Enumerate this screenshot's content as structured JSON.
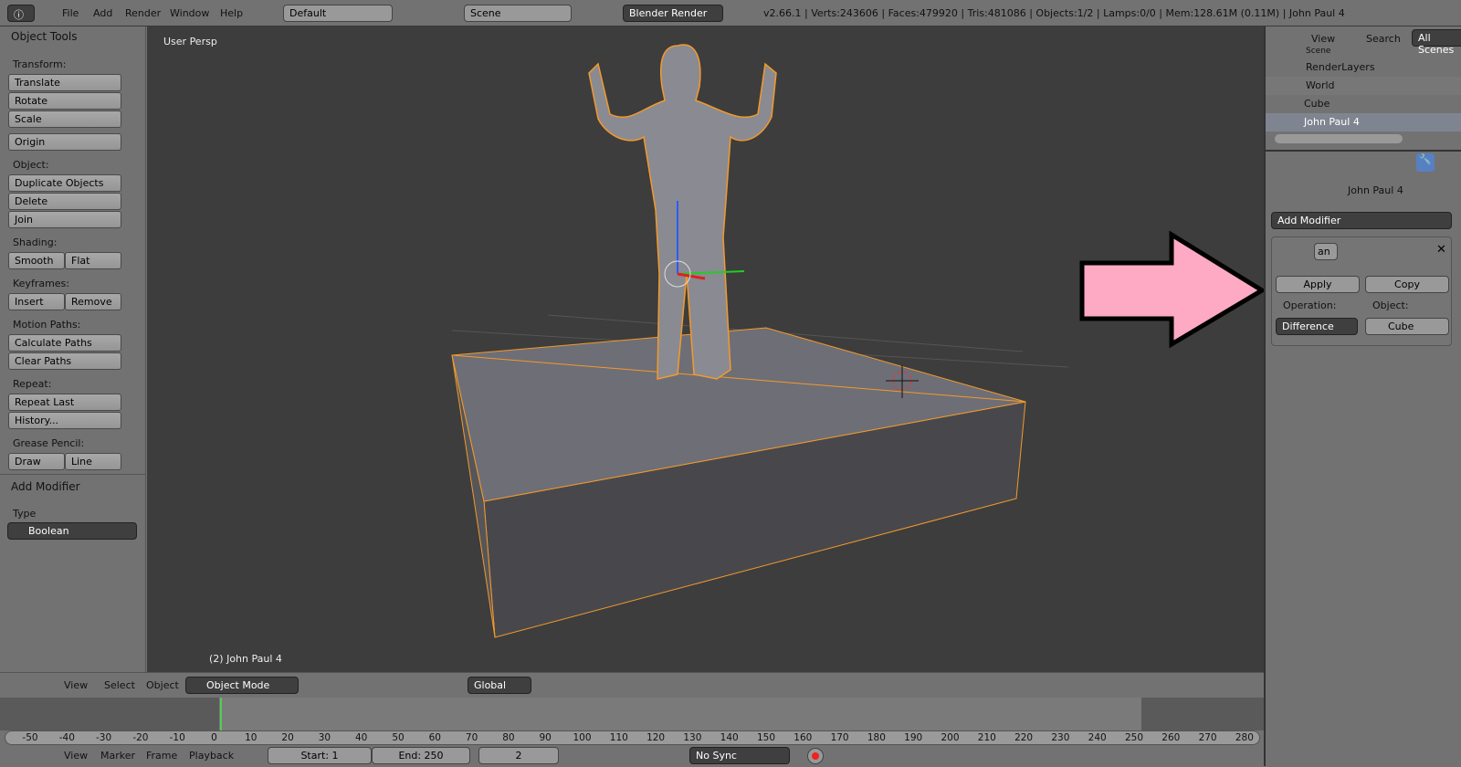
{
  "topbar": {
    "menus": [
      "File",
      "Add",
      "Render",
      "Window",
      "Help"
    ],
    "layout": "Default",
    "scene": "Scene",
    "engine": "Blender Render",
    "info": "v2.66.1 | Verts:243606 | Faces:479920 | Tris:481086 | Objects:1/2 | Lamps:0/0 | Mem:128.61M (0.11M) | John Paul 4"
  },
  "toolshelf": {
    "title": "Object Tools",
    "transform": "Transform:",
    "translate": "Translate",
    "rotate": "Rotate",
    "scale": "Scale",
    "origin": "Origin",
    "object": "Object:",
    "duplicate": "Duplicate Objects",
    "delete": "Delete",
    "join": "Join",
    "shading": "Shading:",
    "smooth": "Smooth",
    "flat": "Flat",
    "keyframes": "Keyframes:",
    "insert": "Insert",
    "remove": "Remove",
    "motion": "Motion Paths:",
    "calc": "Calculate Paths",
    "clear": "Clear Paths",
    "repeat": "Repeat:",
    "repeat_last": "Repeat Last",
    "history": "History...",
    "grease": "Grease Pencil:",
    "draw": "Draw",
    "line": "Line",
    "add_modifier": "Add Modifier",
    "type": "Type",
    "type_value": "Boolean"
  },
  "viewport": {
    "label": "User Persp",
    "object_label": "(2) John Paul 4"
  },
  "view_header": {
    "menus": [
      "View",
      "Select",
      "Object"
    ],
    "mode": "Object Mode",
    "orientation": "Global"
  },
  "timeline": {
    "ticks": [
      "-50",
      "-40",
      "-30",
      "-20",
      "-10",
      "0",
      "10",
      "20",
      "30",
      "40",
      "50",
      "60",
      "70",
      "80",
      "90",
      "100",
      "110",
      "120",
      "130",
      "140",
      "150",
      "160",
      "170",
      "180",
      "190",
      "200",
      "210",
      "220",
      "230",
      "240",
      "250",
      "260",
      "270",
      "280"
    ],
    "current_frame": 2
  },
  "bottom": {
    "menus": [
      "View",
      "Marker",
      "Frame",
      "Playback"
    ],
    "start": "Start: 1",
    "end": "End: 250",
    "frame": "2",
    "sync": "No Sync"
  },
  "outliner": {
    "menus": [
      "View",
      "Search"
    ],
    "filter": "All Scenes",
    "items": [
      "Scene",
      "RenderLayers",
      "World",
      "Cube",
      "John Paul 4"
    ]
  },
  "properties": {
    "object": "John Paul 4",
    "add_modifier": "Add Modifier",
    "mod_name": "an",
    "apply": "Apply",
    "copy": "Copy",
    "operation_label": "Operation:",
    "operation": "Difference",
    "object_label": "Object:",
    "object_value": "Cube"
  },
  "colors": {
    "selection": "#f39a2b",
    "arrow": "#ffaac4",
    "active_tab": "#5680c2"
  }
}
